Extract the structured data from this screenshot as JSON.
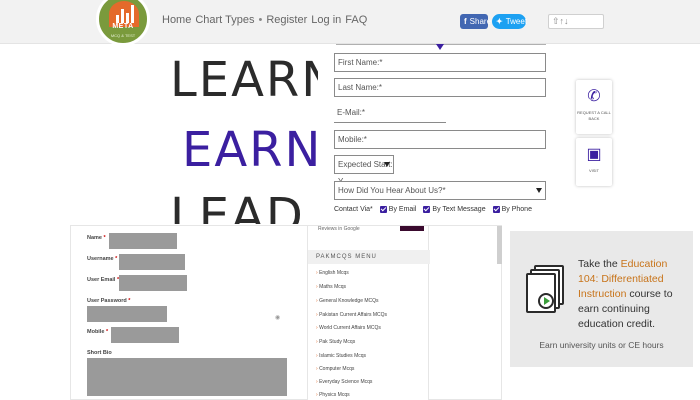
{
  "header": {
    "nav": [
      "Home",
      "Chart Types",
      "Register",
      "Log in",
      "FAQ"
    ],
    "nav_separator": "•",
    "share_facebook": "Share",
    "share_twitter": "Tweet",
    "logo_text": "META",
    "logo_subtext": "MCQ & TEST"
  },
  "banner": {
    "word1": "LEARN",
    "word2": "EARN",
    "word3": "LEAD",
    "accent_color": "#3b1fa0"
  },
  "lead_form": {
    "first_name": "First Name:*",
    "last_name": "Last Name:*",
    "email": "E-Mail:*",
    "mobile": "Mobile:*",
    "expected_start": "Expected Start: Y",
    "how_heard": "How Did You Hear About Us?*",
    "contact_label": "Contact Via*",
    "contact_options": [
      "By Email",
      "By Text Message",
      "By Phone"
    ]
  },
  "widgets": {
    "call": {
      "icon": "phone-icon",
      "label": "REQUEST A CALL BACK"
    },
    "visit": {
      "icon": "person-board-icon",
      "label": "VISIT"
    }
  },
  "profile_form": {
    "fields": [
      {
        "label": "Name",
        "required": "*"
      },
      {
        "label": "Username",
        "required": "*"
      },
      {
        "label": "User Email",
        "required": "*"
      },
      {
        "label": "User Password",
        "required": "*"
      },
      {
        "label": "Mobile",
        "required": "*"
      },
      {
        "label": "Short Bio",
        "required": ""
      }
    ]
  },
  "side_menu": {
    "google_text": "Reviews in Google",
    "title": "PAKMCQS MENU",
    "items": [
      "English Mcqs",
      "Maths Mcqs",
      "General Knowledge MCQs",
      "Pakistan Current Affairs MCQs",
      "World Current Affairs MCQs",
      "Pak Study Mcqs",
      "Islamic Studies Mcqs",
      "Computer Mcqs",
      "Everyday Science Mcqs",
      "Physics Mcqs"
    ]
  },
  "promo": {
    "pre": "Take the ",
    "highlight": "Education 104: Differentiated Instruction",
    "post": " course to earn continuing education credit.",
    "footer": "Earn university units or CE hours"
  }
}
